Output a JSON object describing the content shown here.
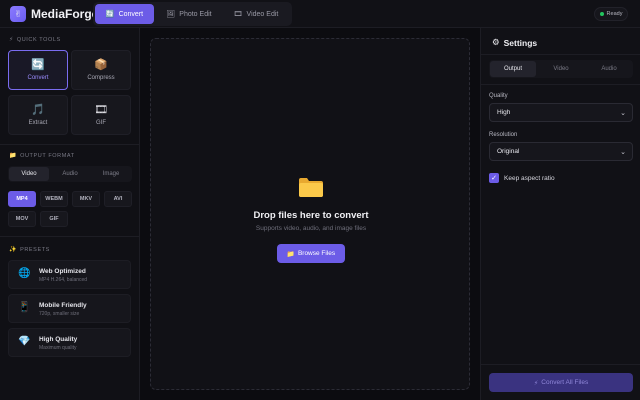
{
  "app": {
    "title": "MediaForge",
    "logo_icon": "✌"
  },
  "header": {
    "tabs": [
      {
        "label": "Convert",
        "icon": "🔄",
        "active": true
      },
      {
        "label": "Photo Edit",
        "icon": "🖼",
        "active": false
      },
      {
        "label": "Video Edit",
        "icon": "🎞",
        "active": false
      }
    ],
    "status": "Ready"
  },
  "sidebar": {
    "quick_tools_title": "QUICK TOOLS",
    "quick_tools_icon": "⚡",
    "tools": [
      {
        "label": "Convert",
        "icon": "🔄",
        "active": true
      },
      {
        "label": "Compress",
        "icon": "📦",
        "active": false
      },
      {
        "label": "Extract",
        "icon": "🎵",
        "active": false
      },
      {
        "label": "GIF",
        "icon": "🎞",
        "active": false
      }
    ],
    "output_format_title": "OUTPUT FORMAT",
    "output_format_icon": "📁",
    "format_tabs": [
      {
        "label": "Video",
        "active": true
      },
      {
        "label": "Audio",
        "active": false
      },
      {
        "label": "Image",
        "active": false
      }
    ],
    "formats": [
      "MP4",
      "WEBM",
      "MKV",
      "AVI",
      "MOV",
      "GIF"
    ],
    "selected_format": "MP4",
    "presets_title": "PRESETS",
    "presets_icon": "✨",
    "presets": [
      {
        "name": "Web Optimized",
        "desc": "MP4 H.264, balanced",
        "icon": "🌐"
      },
      {
        "name": "Mobile Friendly",
        "desc": "720p, smaller size",
        "icon": "📱"
      },
      {
        "name": "High Quality",
        "desc": "Maximum quality",
        "icon": "💎"
      }
    ]
  },
  "dropzone": {
    "title": "Drop files here to convert",
    "subtitle": "Supports video, audio, and image files",
    "browse_label": "Browse Files",
    "browse_icon": "📁"
  },
  "settings": {
    "title": "Settings",
    "title_icon": "⚙",
    "tabs": [
      {
        "label": "Output",
        "active": true
      },
      {
        "label": "Video",
        "active": false
      },
      {
        "label": "Audio",
        "active": false
      }
    ],
    "quality_label": "Quality",
    "quality_value": "High",
    "resolution_label": "Resolution",
    "resolution_value": "Original",
    "keep_aspect_label": "Keep aspect ratio",
    "keep_aspect_checked": true,
    "convert_all_label": "Convert All Files",
    "convert_all_icon": "⚡"
  },
  "colors": {
    "accent": "#6c5ce7",
    "ready": "#22c55e",
    "background": "#0c0c10"
  }
}
